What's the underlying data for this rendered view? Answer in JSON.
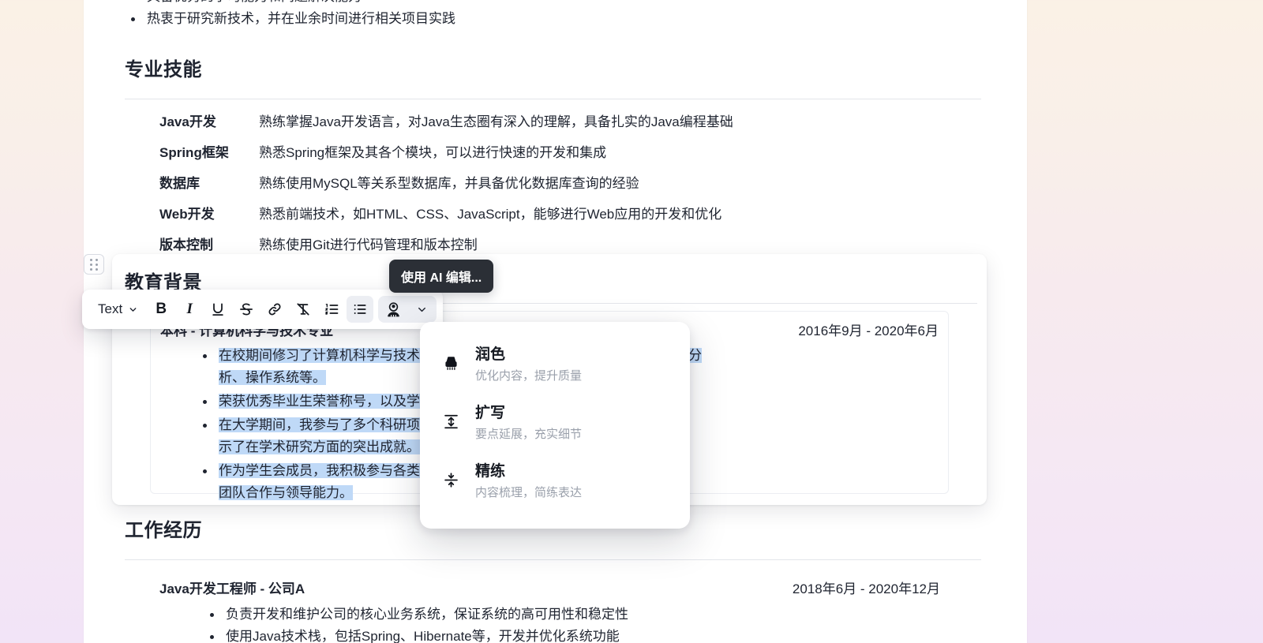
{
  "background": {
    "top_color": "#faf1e6",
    "bottom_color": "#f2e4f7"
  },
  "document": {
    "top_bullets": [
      "具备优秀的学习能力和问题解决能力",
      "热衷于研究新技术，并在业余时间进行相关项目实践"
    ],
    "skills_section": {
      "title": "专业技能",
      "rows": [
        {
          "name": "Java开发",
          "desc": "熟练掌握Java开发语言，对Java生态圈有深入的理解，具备扎实的Java编程基础"
        },
        {
          "name": "Spring框架",
          "desc": "熟悉Spring框架及其各个模块，可以进行快速的开发和集成"
        },
        {
          "name": "数据库",
          "desc": "熟练使用MySQL等关系型数据库，并具备优化数据库查询的经验"
        },
        {
          "name": "Web开发",
          "desc": "熟悉前端技术，如HTML、CSS、JavaScript，能够进行Web应用的开发和优化"
        },
        {
          "name": "版本控制",
          "desc": "熟练使用Git进行代码管理和版本控制"
        }
      ]
    },
    "education_section": {
      "title": "教育背景",
      "degree": "本科 - 计算机科学与技术专业",
      "date": "2016年9月 - 2020年6月",
      "bullets": [
        {
          "parts": [
            {
              "text": "在校期间修习了计算机科学与技术专业的核心课程，包括数据结构、算法设计与分",
              "highlight": true
            },
            {
              "text": "析、操作系统等。",
              "highlight": true
            }
          ]
        },
        {
          "parts": [
            {
              "text": "荣获优秀毕业生荣誉称号，以及学校颁发的多项学业奖学金。",
              "highlight": true
            }
          ]
        },
        {
          "parts": [
            {
              "text": "在大学期间，我参与了多个科研项目，并在权威期刊上发表论文十余次，展",
              "highlight": true
            },
            {
              "text": "示了在学术研究方面的突出成就。",
              "highlight": true
            }
          ]
        },
        {
          "parts": [
            {
              "text": "作为学生会成员，我积极参与各类校园活动的组织与策划工作，锻炼了",
              "highlight": true
            },
            {
              "text": "团队合作与领导能力。",
              "highlight": true
            }
          ]
        }
      ]
    },
    "work_section": {
      "title": "工作经历",
      "role": "Java开发工程师 - 公司A",
      "date": "2018年6月 - 2020年12月",
      "bullets": [
        "负责开发和维护公司的核心业务系统，保证系统的高可用性和稳定性",
        "使用Java技术栈，包括Spring、Hibernate等，开发并优化系统功能"
      ]
    }
  },
  "drag_handle": {
    "name": "drag-handle"
  },
  "toolbar": {
    "style_label": "Text",
    "buttons": [
      {
        "name": "bold-button",
        "label": "B"
      },
      {
        "name": "italic-button",
        "label": "I"
      },
      {
        "name": "underline-button",
        "label": "U"
      },
      {
        "name": "strikethrough-button",
        "label": "S"
      },
      {
        "name": "link-button",
        "label": "链接"
      },
      {
        "name": "clear-format-button",
        "label": "清除格式"
      },
      {
        "name": "ordered-list-button",
        "label": "有序列表"
      },
      {
        "name": "bullet-list-button",
        "label": "无序列表"
      }
    ],
    "ai_button_label": "AI",
    "active_button": "bullet-list-button"
  },
  "tooltip": {
    "text": "使用 AI 编辑..."
  },
  "ai_menu": {
    "items": [
      {
        "icon": "polish-icon",
        "title": "润色",
        "subtitle": "优化内容，提升质量"
      },
      {
        "icon": "expand-vertical-icon",
        "title": "扩写",
        "subtitle": "要点延展，充实细节"
      },
      {
        "icon": "compress-vertical-icon",
        "title": "精练",
        "subtitle": "内容梳理，简练表达"
      }
    ]
  },
  "colors": {
    "selection_highlight": "#bfd9f7",
    "tooltip_bg": "#2b2f36",
    "toolbar_active_bg": "#eceef3",
    "text": "#1f2430",
    "muted": "#9aa0ab"
  }
}
